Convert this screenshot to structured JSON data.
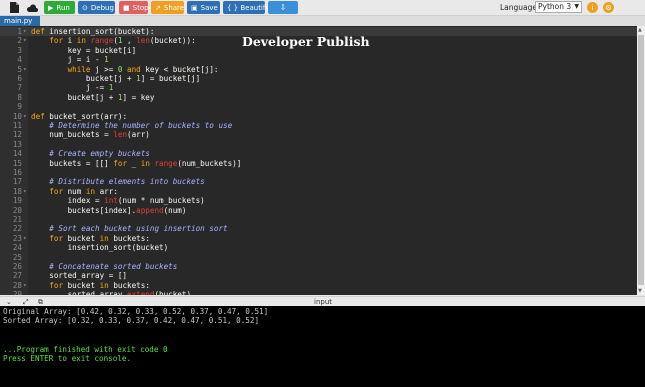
{
  "toolbar": {
    "run": "Run",
    "debug": "Debug",
    "stop": "Stop",
    "share": "Share",
    "save": "Save",
    "beautify": "{ } Beautify",
    "language_label": "Language",
    "language_value": "Python 3",
    "colors": {
      "run": "#2eaa36",
      "debug": "#2e6fb5",
      "stop": "#e06060",
      "share": "#f0a020",
      "save": "#2e6fb5",
      "beautify": "#2e6fb5",
      "download": "#3a8fd8"
    }
  },
  "tabs": [
    {
      "label": "main.py"
    }
  ],
  "watermark": "Developer Publish",
  "code_lines": [
    {
      "n": "1",
      "tokens": [
        [
          "kw",
          "def "
        ],
        [
          "",
          "insertion_sort(bucket):"
        ]
      ],
      "fold": true
    },
    {
      "n": "2",
      "tokens": [
        [
          "",
          "    "
        ],
        [
          "kw",
          "for "
        ],
        [
          "",
          "i "
        ],
        [
          "kw",
          "in "
        ],
        [
          "bi",
          "range"
        ],
        [
          "",
          "("
        ],
        [
          "nm",
          "1"
        ],
        [
          "",
          " , "
        ],
        [
          "bi",
          "len"
        ],
        [
          "",
          "(bucket)):"
        ]
      ],
      "fold": true
    },
    {
      "n": "3",
      "tokens": [
        [
          "",
          "        key = bucket[i]"
        ]
      ]
    },
    {
      "n": "4",
      "tokens": [
        [
          "",
          "        j = i - "
        ],
        [
          "nm",
          "1"
        ]
      ]
    },
    {
      "n": "5",
      "tokens": [
        [
          "",
          "        "
        ],
        [
          "kw",
          "while "
        ],
        [
          "",
          "j >= "
        ],
        [
          "nm",
          "0 "
        ],
        [
          "kw",
          "and "
        ],
        [
          "",
          "key < bucket[j]:"
        ]
      ],
      "fold": true
    },
    {
      "n": "6",
      "tokens": [
        [
          "",
          "            bucket[j + "
        ],
        [
          "nm",
          "1"
        ],
        [
          "",
          "] = bucket[j]"
        ]
      ]
    },
    {
      "n": "7",
      "tokens": [
        [
          "",
          "            j -= "
        ],
        [
          "nm",
          "1"
        ]
      ]
    },
    {
      "n": "8",
      "tokens": [
        [
          "",
          "        bucket[j + "
        ],
        [
          "nm",
          "1"
        ],
        [
          "",
          "] = key"
        ]
      ]
    },
    {
      "n": "9",
      "tokens": [
        [
          "",
          ""
        ]
      ]
    },
    {
      "n": "10",
      "tokens": [
        [
          "kw",
          "def "
        ],
        [
          "",
          "bucket_sort(arr):"
        ]
      ],
      "fold": true
    },
    {
      "n": "11",
      "tokens": [
        [
          "cm",
          "    # Determine the number of buckets to use"
        ]
      ]
    },
    {
      "n": "12",
      "tokens": [
        [
          "",
          "    num_buckets = "
        ],
        [
          "bi",
          "len"
        ],
        [
          "",
          "(arr)"
        ]
      ]
    },
    {
      "n": "13",
      "tokens": [
        [
          "",
          ""
        ]
      ]
    },
    {
      "n": "14",
      "tokens": [
        [
          "cm",
          "    # Create empty buckets"
        ]
      ]
    },
    {
      "n": "15",
      "tokens": [
        [
          "",
          "    buckets = [[] "
        ],
        [
          "kw",
          "for "
        ],
        [
          "",
          "_ "
        ],
        [
          "kw",
          "in "
        ],
        [
          "bi",
          "range"
        ],
        [
          "",
          "(num_buckets)]"
        ]
      ]
    },
    {
      "n": "16",
      "tokens": [
        [
          "",
          ""
        ]
      ]
    },
    {
      "n": "17",
      "tokens": [
        [
          "cm",
          "    # Distribute elements into buckets"
        ]
      ]
    },
    {
      "n": "18",
      "tokens": [
        [
          "",
          "    "
        ],
        [
          "kw",
          "for "
        ],
        [
          "",
          "num "
        ],
        [
          "kw",
          "in "
        ],
        [
          "",
          "arr:"
        ]
      ],
      "fold": true
    },
    {
      "n": "19",
      "tokens": [
        [
          "",
          "        index = "
        ],
        [
          "bi",
          "int"
        ],
        [
          "",
          "(num * num_buckets)"
        ]
      ]
    },
    {
      "n": "20",
      "tokens": [
        [
          "",
          "        buckets[index]."
        ],
        [
          "bi",
          "append"
        ],
        [
          "",
          "(num)"
        ]
      ]
    },
    {
      "n": "21",
      "tokens": [
        [
          "",
          ""
        ]
      ]
    },
    {
      "n": "22",
      "tokens": [
        [
          "cm",
          "    # Sort each bucket using insertion sort"
        ]
      ]
    },
    {
      "n": "23",
      "tokens": [
        [
          "",
          "    "
        ],
        [
          "kw",
          "for "
        ],
        [
          "",
          "bucket "
        ],
        [
          "kw",
          "in "
        ],
        [
          "",
          "buckets:"
        ]
      ],
      "fold": true
    },
    {
      "n": "24",
      "tokens": [
        [
          "",
          "        insertion_sort(bucket)"
        ]
      ]
    },
    {
      "n": "25",
      "tokens": [
        [
          "",
          ""
        ]
      ]
    },
    {
      "n": "26",
      "tokens": [
        [
          "cm",
          "    # Concatenate sorted buckets"
        ]
      ]
    },
    {
      "n": "27",
      "tokens": [
        [
          "",
          "    sorted_array = []"
        ]
      ]
    },
    {
      "n": "28",
      "tokens": [
        [
          "",
          "    "
        ],
        [
          "kw",
          "for "
        ],
        [
          "",
          "bucket "
        ],
        [
          "kw",
          "in "
        ],
        [
          "",
          "buckets:"
        ]
      ],
      "fold": true
    },
    {
      "n": "29",
      "tokens": [
        [
          "",
          "        sorted_array."
        ],
        [
          "bi",
          "extend"
        ],
        [
          "",
          "(bucket)"
        ]
      ]
    }
  ],
  "console": {
    "title": "input",
    "lines": [
      {
        "text": "Original Array: [0.42, 0.32, 0.33, 0.52, 0.37, 0.47, 0.51]",
        "color": "normal"
      },
      {
        "text": "Sorted Array: [0.32, 0.33, 0.37, 0.42, 0.47, 0.51, 0.52]",
        "color": "normal"
      },
      {
        "text": "",
        "color": "normal"
      },
      {
        "text": "",
        "color": "normal"
      },
      {
        "text": "...Program finished with exit code 0",
        "color": "green"
      },
      {
        "text": "Press ENTER to exit console.",
        "color": "green"
      }
    ]
  }
}
